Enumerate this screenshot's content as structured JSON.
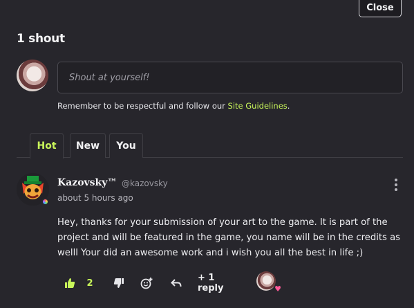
{
  "header": {
    "close_label": "Close",
    "title": "1 shout"
  },
  "composer": {
    "placeholder": "Shout at yourself!",
    "notice_prefix": "Remember to be respectful and follow our ",
    "notice_link": "Site Guidelines",
    "notice_suffix": "."
  },
  "tabs": [
    {
      "label": "Hot",
      "active": true
    },
    {
      "label": "New",
      "active": false
    },
    {
      "label": "You",
      "active": false
    }
  ],
  "comment": {
    "author": "Kazovsky™",
    "handle": "@kazovsky",
    "time": "about 5 hours ago",
    "text": "Hey, thanks for your submission of your art to the game. It is part of the project and will be featured in the game, you name will be in the credits as welll Your did an awesome work and i wish you all the best in life ;)",
    "like_count": "2",
    "replies_label": "+ 1 reply"
  },
  "colors": {
    "background": "#27262c",
    "accent": "#c8f55a",
    "heart": "#ff5a99"
  },
  "icons": [
    "thumbs-up-icon",
    "thumbs-down-icon",
    "add-reaction-icon",
    "reply-icon",
    "kebab-menu-icon",
    "heart-icon"
  ]
}
